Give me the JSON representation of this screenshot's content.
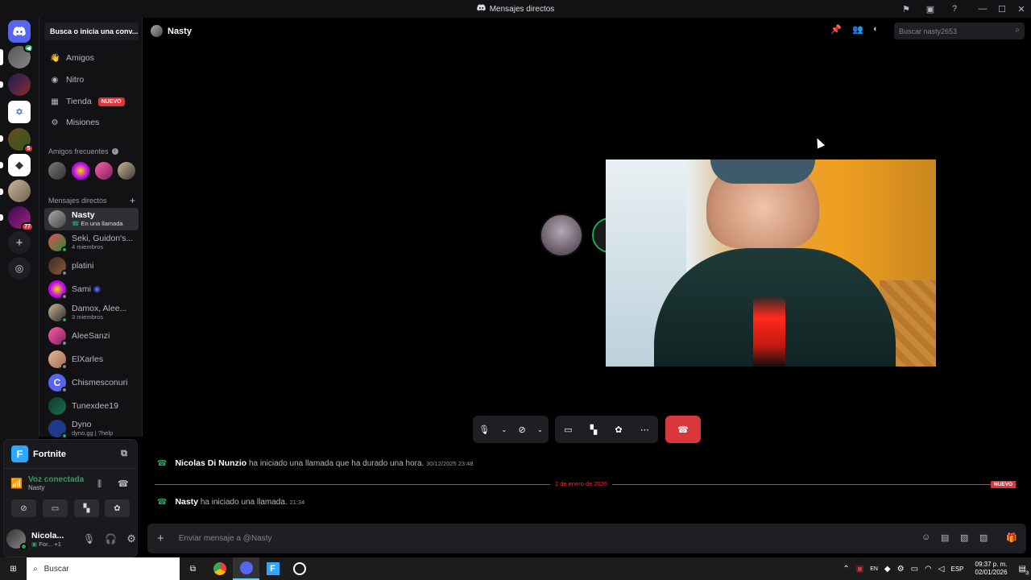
{
  "window": {
    "title": "Mensajes directos"
  },
  "sidebar": {
    "search_button": "Busca o inicia una conv...",
    "nav": [
      {
        "label": "Amigos",
        "icon": "friends-icon"
      },
      {
        "label": "Nitro",
        "icon": "nitro-icon"
      },
      {
        "label": "Tienda",
        "icon": "shop-icon",
        "badge": "NUEVO"
      },
      {
        "label": "Misiones",
        "icon": "quests-icon"
      }
    ],
    "frequent_friends_label": "Amigos frecuentes",
    "dm_section_label": "Mensajes directos",
    "dms": [
      {
        "name": "Nasty",
        "sub": "En una llamada"
      },
      {
        "name": "Seki, Guidon's...",
        "sub": "4 miembros"
      },
      {
        "name": "platini",
        "sub": ""
      },
      {
        "name": "Sami",
        "sub": ""
      },
      {
        "name": "Damox, Alee...",
        "sub": "3 miembros"
      },
      {
        "name": "AleeSanzi",
        "sub": ""
      },
      {
        "name": "ElXarles",
        "sub": ""
      },
      {
        "name": "Chismesconuri",
        "sub": ""
      },
      {
        "name": "Tunexdee19",
        "sub": ""
      },
      {
        "name": "Dyno",
        "sub": "dyno.gg | ?help"
      }
    ],
    "server_badges": {
      "s1": "",
      "s5": "5",
      "s8": "77"
    }
  },
  "voice": {
    "game": "Fortnite",
    "status": "Voz conectada",
    "channel": "Nasty"
  },
  "user": {
    "name": "Nicola...",
    "activity": "For...",
    "extra": "+1"
  },
  "header": {
    "name": "Nasty",
    "search_placeholder": "Buscar nasty2653"
  },
  "messages": [
    {
      "author": "Nicolas Di Nunzio",
      "text": "ha iniciado una llamada que ha durado una hora.",
      "time": "30/12/2025 23:48"
    },
    {
      "author": "Nasty",
      "text": "ha iniciado una llamada.",
      "time": "21:34"
    }
  ],
  "divider": {
    "date": "2 de enero de 2026",
    "badge": "NUEVO"
  },
  "composer": {
    "placeholder": "Enviar mensaje a @Nasty"
  },
  "taskbar": {
    "search": "Buscar",
    "lang": "ESP",
    "time": "09:37 p. m.",
    "date": "02/01/2026",
    "notif": "3"
  },
  "colors": {
    "accent": "#5865f2",
    "danger": "#da373c",
    "online": "#23a55a",
    "bg": "#000000"
  }
}
